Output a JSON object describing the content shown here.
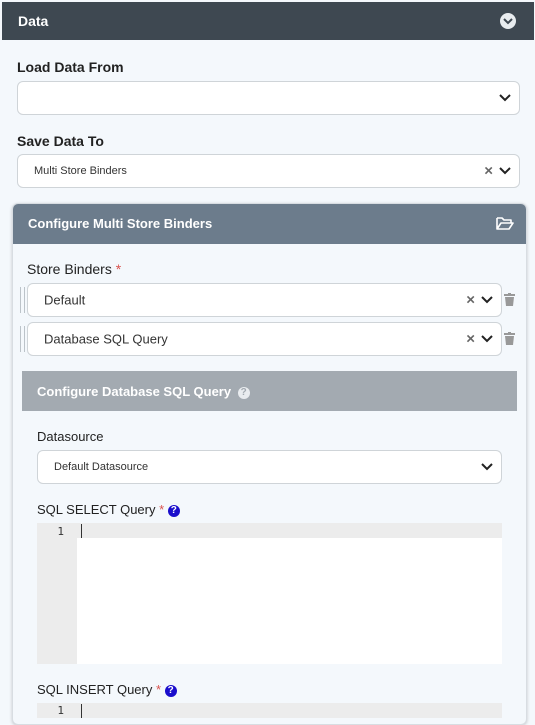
{
  "header": {
    "title": "Data",
    "toggle_icon": "chevron-down-circle-icon"
  },
  "load": {
    "label": "Load Data From",
    "value": ""
  },
  "save": {
    "label": "Save Data To",
    "value": "Multi Store Binders",
    "clear_symbol": "×"
  },
  "configure": {
    "title": "Configure Multi Store Binders",
    "icon": "folder-open-icon",
    "store_binders_label": "Store Binders",
    "required_mark": "*",
    "binders": [
      {
        "value": "Default",
        "clear_symbol": "×"
      },
      {
        "value": "Database SQL Query",
        "clear_symbol": "×"
      }
    ]
  },
  "db_query": {
    "title": "Configure Database SQL Query",
    "help_icon": "question-circle-icon",
    "datasource_label": "Datasource",
    "datasource_value": "Default Datasource",
    "select_label": "SQL SELECT Query",
    "insert_label": "SQL INSERT Query",
    "required_mark": "*",
    "help_symbol": "?",
    "select_line": "1",
    "insert_line": "1"
  },
  "colors": {
    "header_bg": "#3e4851",
    "panel_head_bg": "#6c7c8c",
    "sub_head_bg": "#a3aab1",
    "help_blue": "#1a0dcc",
    "required_red": "#d9534f"
  }
}
